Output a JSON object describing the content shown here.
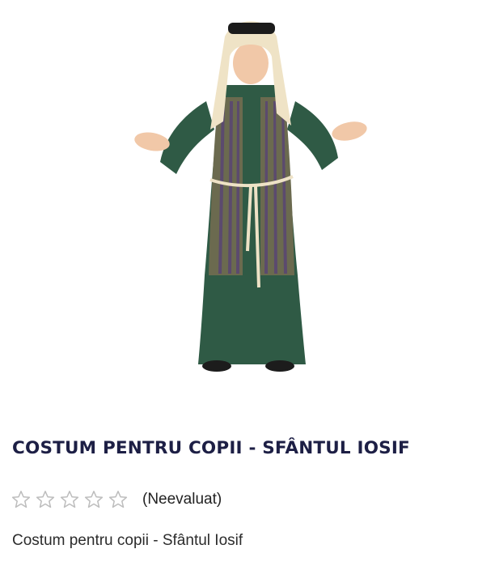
{
  "product": {
    "title": "COSTUM PENTRU COPII - SFÂNTUL IOSIF",
    "rating": {
      "stars_filled": 0,
      "stars_total": 5,
      "label": "(Neevaluat)"
    },
    "short_description": "Costum pentru copii - Sfântul Iosif"
  },
  "colors": {
    "title": "#1d1f45",
    "robe_green": "#2f5a45",
    "headdress": "#efe3c6",
    "star_outline": "#bdbdbd"
  },
  "icons": {
    "star": "star-outline-icon"
  }
}
